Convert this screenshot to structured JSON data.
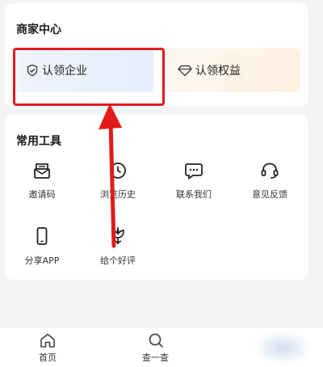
{
  "merchant": {
    "title": "商家中心",
    "claim_enterprise": "认领企业",
    "claim_rights": "认领权益"
  },
  "tools": {
    "title": "常用工具",
    "items": [
      {
        "label": "邀请码",
        "icon": "mail-open-icon"
      },
      {
        "label": "浏览历史",
        "icon": "clock-icon"
      },
      {
        "label": "联系我们",
        "icon": "chat-icon"
      },
      {
        "label": "意见反馈",
        "icon": "headset-icon"
      },
      {
        "label": "分享APP",
        "icon": "phone-icon"
      },
      {
        "label": "给个好评",
        "icon": "flower-icon"
      }
    ]
  },
  "bottom_nav": {
    "home": "首页",
    "search": "查一查"
  },
  "colors": {
    "highlight": "#e11b1b",
    "background": "#f3f4f6"
  }
}
